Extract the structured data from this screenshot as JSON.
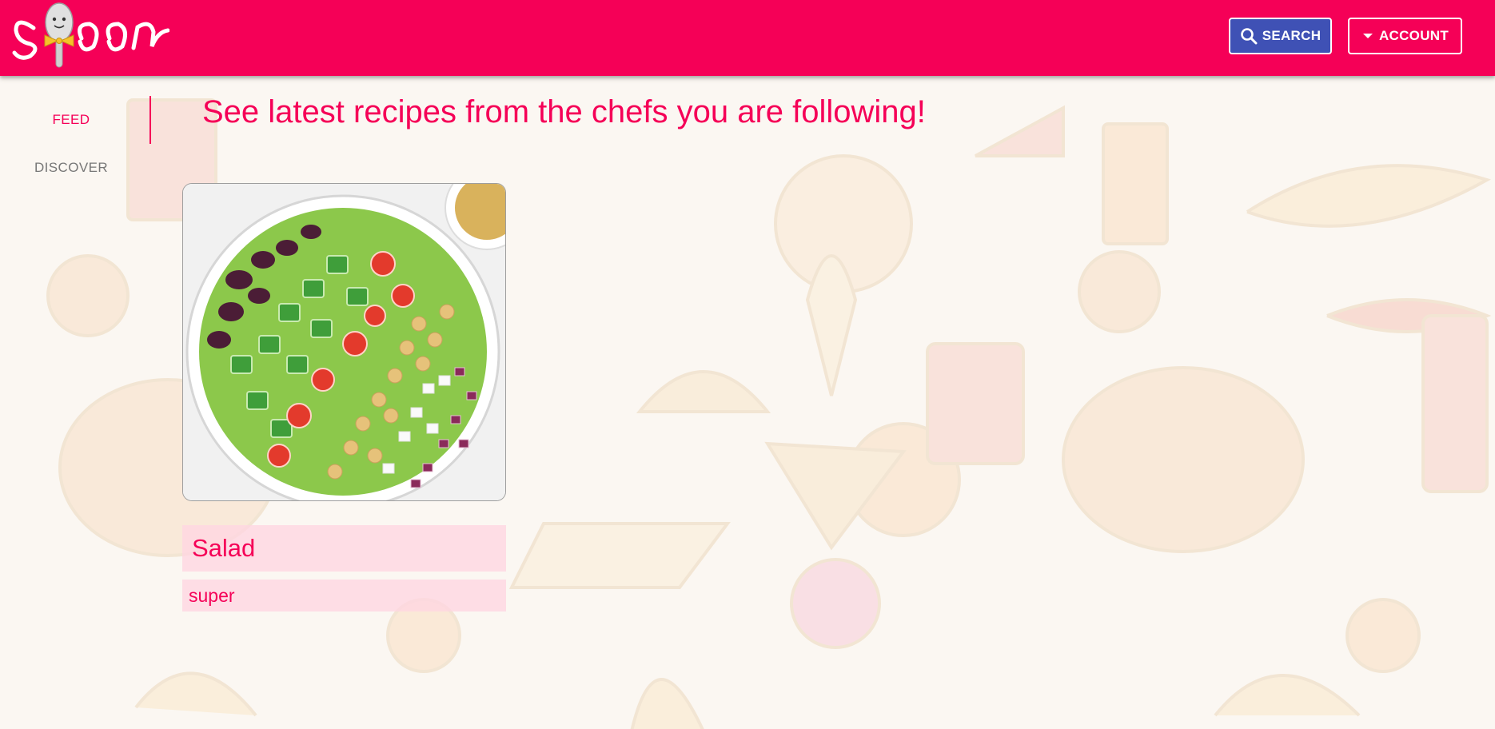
{
  "app": {
    "logo_text": "spoon",
    "brand_color": "#f50057",
    "search_button_color": "#3f51b5"
  },
  "header": {
    "search_label": "SEARCH",
    "search_icon": "search-icon",
    "account_label": "ACCOUNT",
    "account_icon": "caret-down-icon"
  },
  "sidenav": {
    "items": [
      {
        "label": "FEED",
        "active": true
      },
      {
        "label": "DISCOVER",
        "active": false
      }
    ]
  },
  "main": {
    "headline": "See latest recipes from the chefs you are following!",
    "recipes": [
      {
        "title": "Salad",
        "description": "super",
        "image": "salad-bowl-photo"
      }
    ]
  }
}
